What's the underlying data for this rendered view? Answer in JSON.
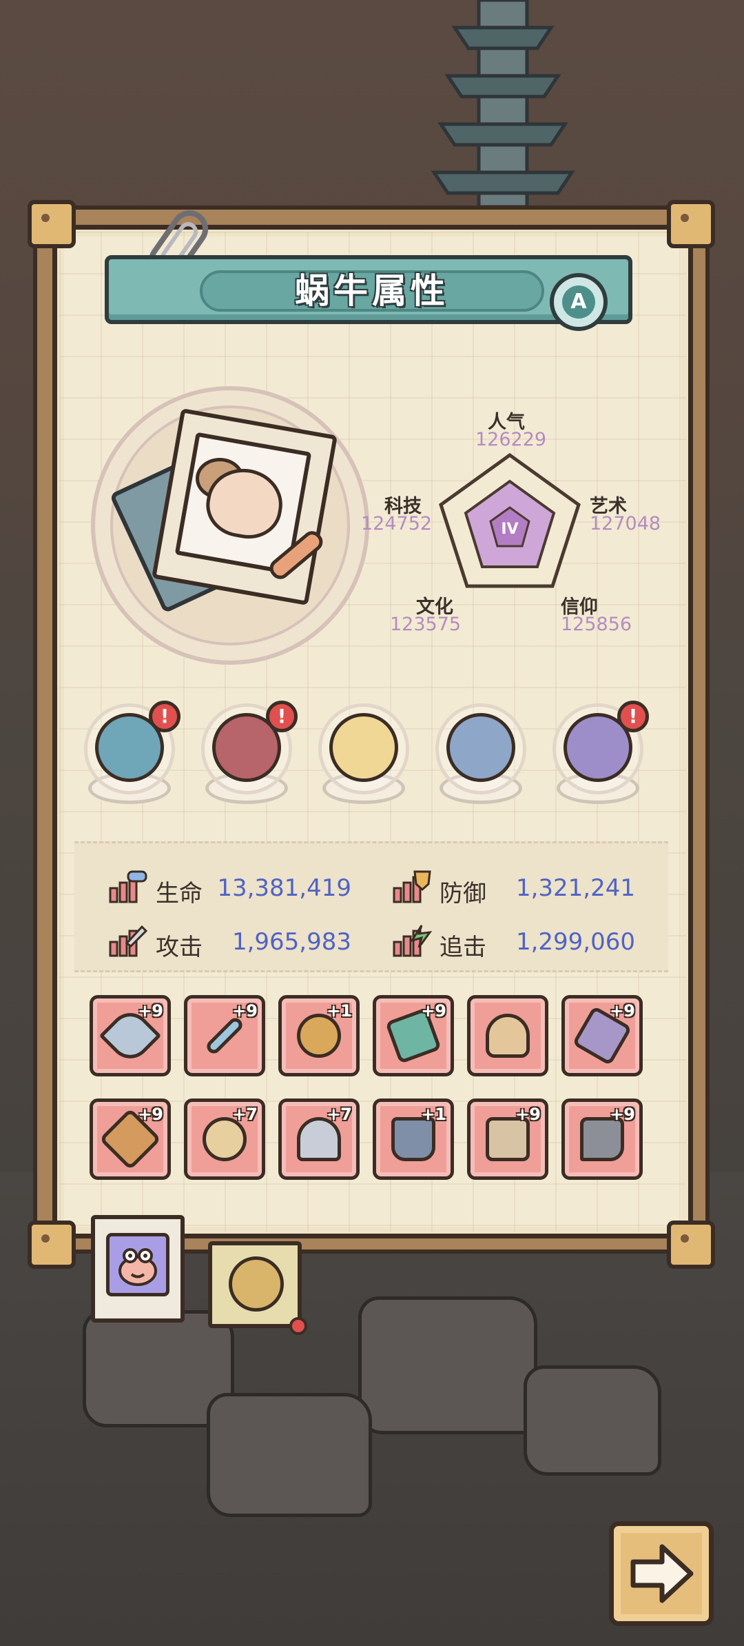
{
  "title": "蜗牛属性",
  "grade_badge": "A",
  "radar": {
    "center_label": "IV",
    "stats": [
      {
        "name": "人气",
        "value": "126229"
      },
      {
        "name": "艺术",
        "value": "127048"
      },
      {
        "name": "信仰",
        "value": "125856"
      },
      {
        "name": "文化",
        "value": "123575"
      },
      {
        "name": "科技",
        "value": "124752"
      }
    ]
  },
  "items": [
    {
      "icon": "sea-monster-icon",
      "alert": "!",
      "color": "#6fa6b8"
    },
    {
      "icon": "demon-mask-icon",
      "alert": "!",
      "color": "#b7646a"
    },
    {
      "icon": "steamed-bun-icon",
      "alert": "",
      "color": "#f0d796"
    },
    {
      "icon": "compass-icon",
      "alert": "",
      "color": "#8ea6c7"
    },
    {
      "icon": "gem-plate-icon",
      "alert": "!",
      "color": "#9d8ec9"
    }
  ],
  "stats": {
    "hp_label": "生命",
    "hp_value": "13,381,419",
    "def_label": "防御",
    "def_value": "1,321,241",
    "atk_label": "攻击",
    "atk_value": "1,965,983",
    "chase_label": "追击",
    "chase_value": "1,299,060"
  },
  "equipment": [
    {
      "icon": "rocket-sword-icon",
      "level": "+9"
    },
    {
      "icon": "sword-icon",
      "level": "+9"
    },
    {
      "icon": "spiked-mace-icon",
      "level": "+1"
    },
    {
      "icon": "dragon-spear-icon",
      "level": "+9"
    },
    {
      "icon": "bone-club-icon",
      "level": ""
    },
    {
      "icon": "serpent-staff-icon",
      "level": "+9"
    },
    {
      "icon": "crossbow-icon",
      "level": "+9"
    },
    {
      "icon": "ring-icon",
      "level": "+7"
    },
    {
      "icon": "helmet-icon",
      "level": "+7"
    },
    {
      "icon": "armor-icon",
      "level": "+1"
    },
    {
      "icon": "pants-icon",
      "level": "+9"
    },
    {
      "icon": "boots-icon",
      "level": "+9"
    }
  ],
  "tabs": [
    {
      "icon": "snail-face-icon",
      "active": true
    },
    {
      "icon": "shell-icon",
      "active": false
    }
  ],
  "colors": {
    "equip_bg": "#ef9f98",
    "stat_value": "#4f63c4",
    "radar_value": "#b48cc0",
    "title_bar": "#7fb9b4"
  }
}
